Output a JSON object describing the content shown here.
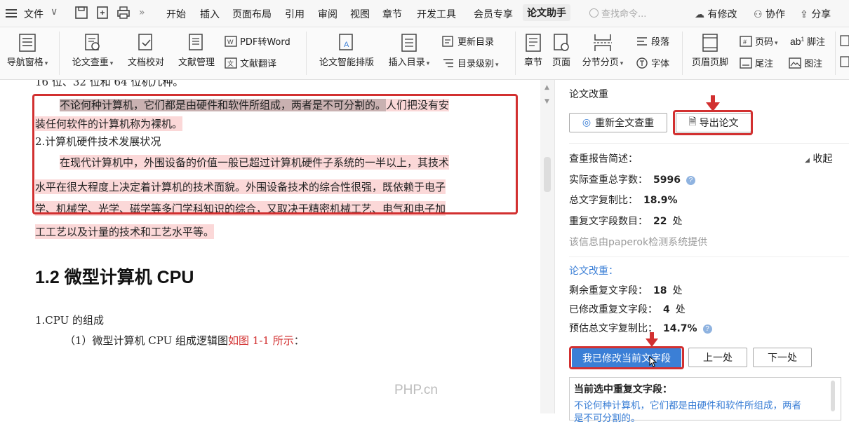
{
  "menubar": {
    "file_label": "文件",
    "tabs": [
      "开始",
      "插入",
      "页面布局",
      "引用",
      "审阅",
      "视图",
      "章节",
      "开发工具",
      "会员专享",
      "论文助手"
    ],
    "search_placeholder": "查找命令...",
    "right_items": [
      "有修改",
      "协作",
      "分享"
    ]
  },
  "ribbon": {
    "big": [
      {
        "label": "导航窗格"
      },
      {
        "label": "论文查重"
      },
      {
        "label": "文档校对"
      },
      {
        "label": "文献管理"
      },
      {
        "label": "论文智能排版"
      },
      {
        "label": "插入目录"
      },
      {
        "label": "章节"
      },
      {
        "label": "页面"
      },
      {
        "label": "分节分页"
      },
      {
        "label": "页眉页脚"
      }
    ],
    "small": {
      "pdf_to_word": "PDF转Word",
      "doc_translate": "文献翻译",
      "update_toc": "更新目录",
      "toc_level": "目录级别",
      "paragraph": "段落",
      "font": "字体",
      "page_num": "页码",
      "footnote": "脚注",
      "endnote": "尾注",
      "caption": "图注"
    }
  },
  "doc": {
    "line0": "16 位、32 位和 64 位机几种。",
    "p1_a": "不论何种计算机，它们都是由硬件和软件所组成，两者是不可分割的。",
    "p1_b": "人们把没有安",
    "p1_c": "装任何软件的计算机称为裸机。",
    "h2": "2.计算机硬件技术发展状况",
    "p2_a": "在现代计算机中，外围设备的价值一般已超过计算机硬件子系统的一半以上，其技术",
    "p2_b": "水平在很大程度上决定着计算机的技术面貌。外围设备技术的综合性很强，既依赖于电子",
    "p2_c": "学、机械学、光学、磁学等多门学科知识的综合，又取决于精密机械工艺、电气和电子加",
    "p2_d": "工工艺以及计量的技术和工艺水平等。",
    "section_title": "1.2  微型计算机 CPU",
    "sub1": "1.CPU 的组成",
    "sub2_a": "（1）微型计算机 CPU 组成逻辑图",
    "sub2_b": "如图 1-1 所示",
    "sub2_c": "：",
    "watermark": "PHP.cn"
  },
  "panel": {
    "title": "论文改重",
    "btn_recheck": "重新全文查重",
    "btn_export": "导出论文",
    "report_title": "查重报告简述：",
    "collapse": "收起",
    "total_words_label": "实际查重总字数：",
    "total_words": "5996",
    "copy_ratio_label": "总文字复制比：",
    "copy_ratio": "18.9%",
    "dup_count_label": "重复文字段数目：",
    "dup_count": "22",
    "unit": "处",
    "provider_note": "该信息由paperok检测系统提供",
    "rewrite_title": "论文改重：",
    "remain_label": "剩余重复文字段：",
    "remain": "18",
    "modified_label": "已修改重复文字段：",
    "modified": "4",
    "estimate_label": "预估总文字复制比：",
    "estimate": "14.7%",
    "btn_modified": "我已修改当前文字段",
    "btn_prev": "上一处",
    "btn_next": "下一处",
    "current_title": "当前选中重复文字段：",
    "current_text": "不论何种计算机，它们都是由硬件和软件所组成，两者",
    "current_text2": "是不可分割的。"
  },
  "colors": {
    "accent_red": "#d23030",
    "primary_blue": "#3b7fd6",
    "highlight_pink": "#fbd8d8"
  }
}
